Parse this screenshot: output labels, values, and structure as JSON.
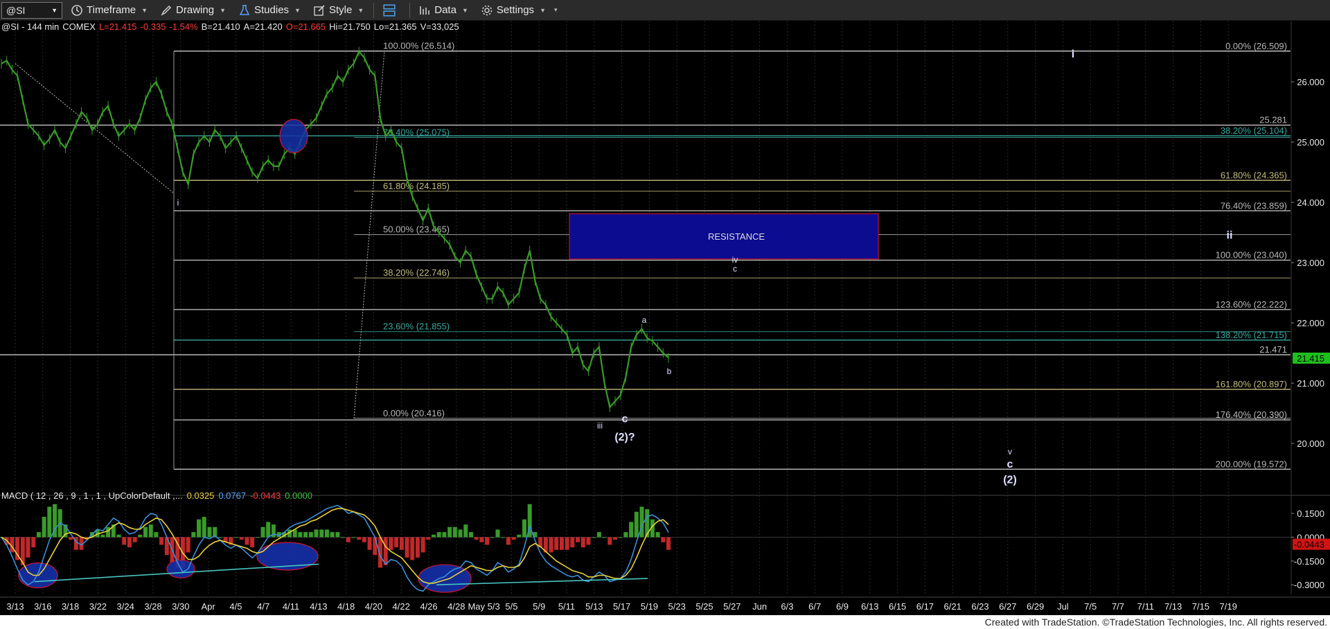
{
  "toolbar": {
    "symbol": "@SI",
    "items": [
      {
        "icon": "timeframe-icon",
        "label": "Timeframe"
      },
      {
        "icon": "drawing-icon",
        "label": "Drawing"
      },
      {
        "icon": "studies-icon",
        "label": "Studies"
      },
      {
        "icon": "style-icon",
        "label": "Style"
      },
      {
        "icon": "layout-icon",
        "label": ""
      },
      {
        "icon": "data-icon",
        "label": "Data"
      },
      {
        "icon": "settings-icon",
        "label": "Settings"
      }
    ]
  },
  "colors": {
    "background": "#000000",
    "price": "#3a9a2a",
    "fib_gray": "#b8b8b8",
    "fib_teal": "#3aa7a0",
    "fib_tan": "#c2bb7e",
    "resistance_fill": "#0b0c8f",
    "resistance_border": "#c4122e",
    "macd_line": "#3a8fd8",
    "signal_line": "#e8d23a",
    "hist_pos": "#3a9a2a",
    "hist_neg": "#c0282a",
    "ellipse_fill": "#1530a8",
    "ellipse_border": "#d0142e",
    "trend_line": "#46c6c2",
    "last_price_bg": "#1dbf1d"
  },
  "footer": "Created with TradeStation. ©TradeStation Technologies, Inc. All rights reserved.",
  "chart_data": [
    {
      "type": "line",
      "pane": "price",
      "header": {
        "symbol": "@SI - 144 min",
        "exchange": "COMEX",
        "last": "L=21.415",
        "change": "-0.335",
        "change_pct": "-1.54%",
        "bid": "B=21.410",
        "ask": "A=21.420",
        "open": "O=21.665",
        "high": "Hi=21.750",
        "low": "Lo=21.365",
        "volume": "V=33,025"
      },
      "ylim": [
        19.22,
        26.92
      ],
      "y_ticks": [
        "26.000",
        "25.000",
        "24.000",
        "23.000",
        "22.000",
        "21.000",
        "20.000"
      ],
      "y_tick_values": [
        26,
        25,
        24,
        23,
        22,
        21,
        20
      ],
      "x_ticks": [
        "3/13",
        "3/16",
        "3/18",
        "3/22",
        "3/24",
        "3/28",
        "3/30",
        "Apr",
        "4/5",
        "4/7",
        "4/11",
        "4/13",
        "4/18",
        "4/20",
        "4/22",
        "4/26",
        "4/28",
        "May 5/3",
        "5/5",
        "5/9",
        "5/11",
        "5/13",
        "5/17",
        "5/19",
        "5/23",
        "5/25",
        "5/27",
        "Jun",
        "6/3",
        "6/7",
        "6/9",
        "6/13",
        "6/15",
        "6/17",
        "6/21",
        "6/23",
        "6/27",
        "6/29",
        "Jul",
        "7/5",
        "7/7",
        "7/11",
        "7/13",
        "7/15",
        "7/19"
      ],
      "x_tick_index": [
        0,
        1,
        2,
        3,
        4,
        5,
        6,
        7,
        8,
        9,
        10,
        11,
        12,
        13,
        14,
        15,
        16,
        17,
        18,
        19,
        20,
        21,
        22,
        23,
        24,
        25,
        26,
        27,
        28,
        29,
        30,
        31,
        32,
        33,
        34,
        35,
        36,
        37,
        38,
        39,
        40,
        41,
        42,
        43,
        44
      ],
      "close": [
        26.3,
        26.35,
        26.2,
        26.1,
        25.7,
        25.3,
        25.2,
        25.1,
        24.95,
        25.05,
        25.2,
        25.0,
        24.9,
        25.1,
        25.3,
        25.5,
        25.4,
        25.2,
        25.3,
        25.5,
        25.6,
        25.3,
        25.1,
        25.2,
        25.3,
        25.2,
        25.4,
        25.7,
        25.9,
        26.0,
        25.8,
        25.5,
        25.3,
        24.9,
        24.5,
        24.3,
        24.8,
        25.0,
        25.1,
        25.0,
        25.2,
        25.1,
        24.9,
        25.0,
        25.1,
        24.9,
        24.7,
        24.5,
        24.4,
        24.6,
        24.7,
        24.6,
        24.6,
        24.8,
        24.9,
        24.8,
        25.0,
        25.2,
        25.3,
        25.4,
        25.6,
        25.8,
        25.9,
        26.1,
        26.0,
        26.2,
        26.3,
        26.5,
        26.4,
        26.2,
        26.1,
        25.4,
        25.1,
        25.2,
        25.0,
        24.9,
        24.4,
        24.1,
        23.9,
        23.7,
        23.9,
        23.6,
        23.5,
        23.4,
        23.3,
        23.1,
        23.0,
        23.2,
        23.1,
        22.8,
        22.6,
        22.4,
        22.4,
        22.6,
        22.5,
        22.3,
        22.4,
        22.5,
        22.9,
        23.2,
        22.7,
        22.4,
        22.3,
        22.1,
        22.0,
        21.9,
        21.8,
        21.5,
        21.6,
        21.3,
        21.2,
        21.5,
        21.6,
        21.0,
        20.6,
        20.7,
        20.8,
        21.1,
        21.6,
        21.8,
        21.9,
        21.75,
        21.7,
        21.6,
        21.5,
        21.42
      ],
      "fib_levels": [
        {
          "label": "0.00% (26.509)",
          "value": 26.509,
          "color": "gray",
          "side": "right"
        },
        {
          "label": "25.281",
          "value": 25.281,
          "color": "gray",
          "side": "right"
        },
        {
          "label": "38.20% (25.104)",
          "value": 25.104,
          "color": "teal",
          "side": "right"
        },
        {
          "label": "61.80% (24.365)",
          "value": 24.365,
          "color": "tan",
          "side": "right"
        },
        {
          "label": "76.40% (23.859)",
          "value": 23.859,
          "color": "gray",
          "side": "right"
        },
        {
          "label": "100.00% (23.040)",
          "value": 23.04,
          "color": "gray",
          "side": "right"
        },
        {
          "label": "123.60% (22.222)",
          "value": 22.222,
          "color": "gray",
          "side": "right"
        },
        {
          "label": "138.20% (21.715)",
          "value": 21.715,
          "color": "teal",
          "side": "right"
        },
        {
          "label": "21.471",
          "value": 21.471,
          "color": "gray",
          "side": "right"
        },
        {
          "label": "161.80% (20.897)",
          "value": 20.897,
          "color": "tan",
          "side": "right"
        },
        {
          "label": "176.40% (20.390)",
          "value": 20.39,
          "color": "gray",
          "side": "right"
        },
        {
          "label": "200.00% (19.572)",
          "value": 19.572,
          "color": "gray",
          "side": "right"
        },
        {
          "label": "100.00% (26.514)",
          "value": 26.514,
          "color": "gray",
          "side": "left"
        },
        {
          "label": "78.40% (25.075)",
          "value": 25.075,
          "color": "teal",
          "side": "left"
        },
        {
          "label": "61.80% (24.185)",
          "value": 24.185,
          "color": "tan",
          "side": "left"
        },
        {
          "label": "50.00% (23.465)",
          "value": 23.465,
          "color": "gray",
          "side": "left"
        },
        {
          "label": "38.20% (22.746)",
          "value": 22.746,
          "color": "tan",
          "side": "left"
        },
        {
          "label": "23.60% (21.855)",
          "value": 21.855,
          "color": "teal",
          "side": "left"
        },
        {
          "label": "0.00% (20.416)",
          "value": 20.416,
          "color": "gray",
          "side": "left"
        }
      ],
      "resistance_zone": {
        "label": "RESISTANCE",
        "top": 23.81,
        "bottom": 23.06
      },
      "wave_labels": [
        {
          "text": "i",
          "value": 23.95,
          "bold": false
        },
        {
          "text": "iii",
          "value": 20.25,
          "bold": false
        },
        {
          "text": "c",
          "value": 20.35,
          "bold": true
        },
        {
          "text": "(2)?",
          "value": 20.05,
          "bold": true
        },
        {
          "text": "a",
          "value": 22.0,
          "bold": false
        },
        {
          "text": "b",
          "value": 21.15,
          "bold": false
        },
        {
          "text": "iv",
          "value": 23.0,
          "bold": false
        },
        {
          "text": "c",
          "value": 22.85,
          "bold": false
        },
        {
          "text": "i",
          "value": 26.4,
          "bold": true
        },
        {
          "text": "ii",
          "value": 23.4,
          "bold": true
        },
        {
          "text": "v",
          "value": 19.82,
          "bold": false
        },
        {
          "text": "c",
          "value": 19.6,
          "bold": true
        },
        {
          "text": "(2)",
          "value": 19.34,
          "bold": true
        }
      ],
      "last_price": {
        "label": "21.415",
        "value": 21.415
      }
    },
    {
      "type": "bar",
      "pane": "macd",
      "header": {
        "name": "MACD ( 12 , 26 , 9 , 1 , 1 , UpColorDefault ,...",
        "macd": "0.0325",
        "signal": "0.0767",
        "diff": "-0.0443",
        "zero": "0.0000"
      },
      "ylim": [
        -0.36,
        0.22
      ],
      "y_ticks": [
        "0.1500",
        "0.0000",
        "-0.1500",
        "-0.3000"
      ],
      "y_tick_values": [
        0.15,
        0,
        -0.15,
        -0.3
      ],
      "last_value": {
        "label": "-0.0443",
        "value": -0.0443
      },
      "macd": [
        0.0,
        -0.05,
        -0.12,
        -0.2,
        -0.27,
        -0.3,
        -0.28,
        -0.22,
        -0.12,
        -0.02,
        0.05,
        0.09,
        0.07,
        0.02,
        -0.03,
        -0.05,
        -0.02,
        0.02,
        0.05,
        0.04,
        0.08,
        0.12,
        0.1,
        0.05,
        0.02,
        0.03,
        0.06,
        0.12,
        0.15,
        0.14,
        0.08,
        0.0,
        -0.08,
        -0.16,
        -0.22,
        -0.2,
        -0.12,
        -0.05,
        0.0,
        -0.01,
        0.01,
        -0.02,
        -0.05,
        -0.07,
        -0.05,
        -0.07,
        -0.1,
        -0.13,
        -0.1,
        -0.05,
        0.0,
        0.02,
        0.01,
        0.03,
        0.06,
        0.08,
        0.09,
        0.1,
        0.12,
        0.14,
        0.16,
        0.18,
        0.19,
        0.2,
        0.18,
        0.15,
        0.16,
        0.14,
        0.12,
        0.06,
        0.0,
        -0.12,
        -0.17,
        -0.14,
        -0.15,
        -0.18,
        -0.25,
        -0.3,
        -0.33,
        -0.34,
        -0.3,
        -0.28,
        -0.26,
        -0.25,
        -0.22,
        -0.2,
        -0.19,
        -0.15,
        -0.16,
        -0.2,
        -0.22,
        -0.24,
        -0.21,
        -0.16,
        -0.18,
        -0.22,
        -0.2,
        -0.17,
        -0.06,
        0.07,
        -0.02,
        -0.1,
        -0.15,
        -0.18,
        -0.2,
        -0.22,
        -0.24,
        -0.25,
        -0.24,
        -0.27,
        -0.28,
        -0.25,
        -0.22,
        -0.24,
        -0.28,
        -0.27,
        -0.26,
        -0.22,
        -0.14,
        -0.03,
        0.07,
        0.13,
        0.14,
        0.12,
        0.09,
        0.03
      ],
      "signal": [
        0.0,
        -0.02,
        -0.06,
        -0.11,
        -0.16,
        -0.22,
        -0.24,
        -0.24,
        -0.2,
        -0.14,
        -0.08,
        -0.02,
        0.02,
        0.03,
        0.02,
        0.0,
        -0.01,
        0.0,
        0.02,
        0.03,
        0.04,
        0.07,
        0.09,
        0.08,
        0.06,
        0.05,
        0.05,
        0.08,
        0.1,
        0.12,
        0.11,
        0.07,
        0.02,
        -0.04,
        -0.1,
        -0.14,
        -0.14,
        -0.12,
        -0.08,
        -0.05,
        -0.03,
        -0.02,
        -0.03,
        -0.04,
        -0.05,
        -0.06,
        -0.07,
        -0.09,
        -0.1,
        -0.09,
        -0.06,
        -0.03,
        -0.01,
        0.01,
        0.03,
        0.05,
        0.07,
        0.08,
        0.1,
        0.11,
        0.13,
        0.15,
        0.17,
        0.18,
        0.18,
        0.17,
        0.16,
        0.15,
        0.14,
        0.11,
        0.07,
        0.0,
        -0.06,
        -0.09,
        -0.11,
        -0.13,
        -0.17,
        -0.21,
        -0.25,
        -0.28,
        -0.29,
        -0.29,
        -0.28,
        -0.27,
        -0.26,
        -0.24,
        -0.22,
        -0.2,
        -0.18,
        -0.19,
        -0.2,
        -0.21,
        -0.21,
        -0.19,
        -0.18,
        -0.19,
        -0.19,
        -0.18,
        -0.13,
        -0.06,
        -0.04,
        -0.06,
        -0.09,
        -0.12,
        -0.15,
        -0.17,
        -0.19,
        -0.21,
        -0.22,
        -0.23,
        -0.25,
        -0.25,
        -0.24,
        -0.24,
        -0.25,
        -0.26,
        -0.26,
        -0.24,
        -0.2,
        -0.13,
        -0.05,
        0.02,
        0.07,
        0.1,
        0.11,
        0.08
      ]
    }
  ]
}
